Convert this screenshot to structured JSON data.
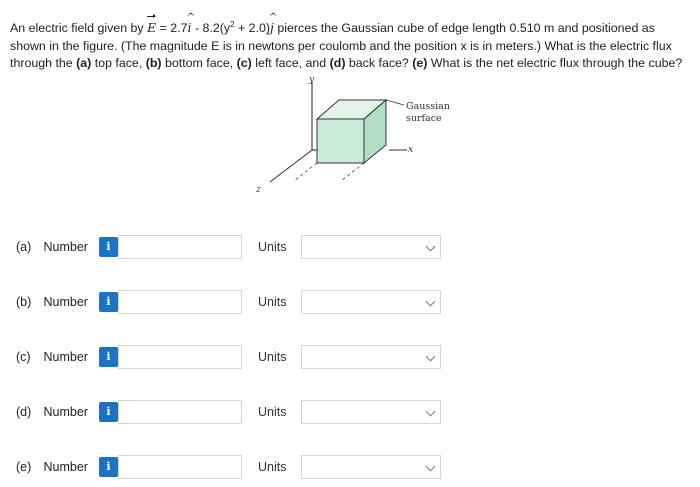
{
  "question": {
    "p1": "An electric field given by ",
    "E": "E",
    "eq1": " = 2.7",
    "i": "i",
    "eq2": " - 8.2(y",
    "sup": "2",
    "eq3": " + 2.0)",
    "j": "j",
    "p2": " pierces the Gaussian cube of edge length 0.510 m and positioned as shown in the figure. (The magnitude E is in newtons per coulomb and the position x is in meters.) What is the electric flux through the ",
    "a_lbl": "(a)",
    "a_txt": " top face, ",
    "b_lbl": "(b)",
    "b_txt": " bottom face, ",
    "c_lbl": "(c)",
    "c_txt": " left face, and ",
    "d_lbl": "(d)",
    "d_txt": " back face? ",
    "e_lbl": "(e)",
    "e_txt": " What is the net electric flux through the cube?"
  },
  "figure": {
    "axis_y": "y",
    "axis_x": "x",
    "axis_z": "z",
    "callout_line1": "Gaussian",
    "callout_line2": "surface"
  },
  "colors": {
    "cube_front": "#c9ecd6",
    "cube_top": "#e3f5ea",
    "cube_side": "#b2dfc3",
    "info_button": "#1a73c8",
    "input_border": "#d5d5d5"
  },
  "answers": [
    {
      "part": "(a)",
      "label": "Number",
      "info_icon": "i",
      "value": "",
      "units_label": "Units",
      "units_value": ""
    },
    {
      "part": "(b)",
      "label": "Number",
      "info_icon": "i",
      "value": "",
      "units_label": "Units",
      "units_value": ""
    },
    {
      "part": "(c)",
      "label": "Number",
      "info_icon": "i",
      "value": "",
      "units_label": "Units",
      "units_value": ""
    },
    {
      "part": "(d)",
      "label": "Number",
      "info_icon": "i",
      "value": "",
      "units_label": "Units",
      "units_value": ""
    },
    {
      "part": "(e)",
      "label": "Number",
      "info_icon": "i",
      "value": "",
      "units_label": "Units",
      "units_value": ""
    }
  ]
}
